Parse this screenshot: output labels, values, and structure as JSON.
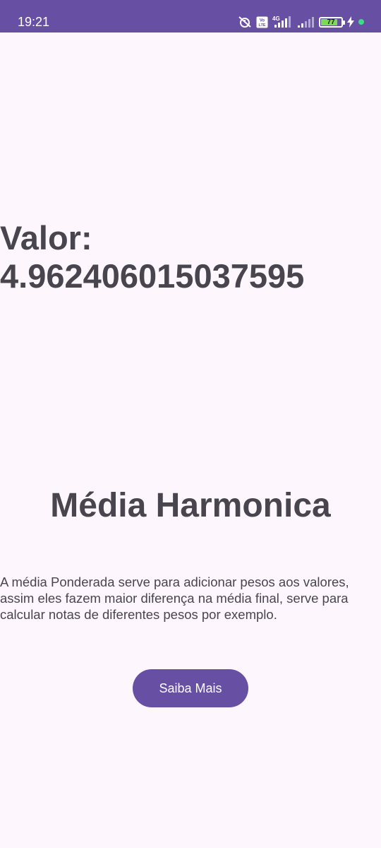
{
  "status_bar": {
    "time": "19:21",
    "battery_level": "77",
    "network_type": "4G",
    "volte_badge": "Vo LTE",
    "icons": [
      "alarm-off-icon",
      "volte-icon",
      "signal-4g-icon",
      "signal-icon",
      "battery-icon",
      "charging-icon",
      "dot-icon"
    ],
    "background_color": "#6750a4",
    "battery_color": "#7ed957",
    "dot_color": "#3ddc84"
  },
  "main": {
    "value_label": "Valor: 4.962406015037595",
    "title": "Média Harmonica",
    "description": "A média Ponderada serve para adicionar pesos aos valores, assim eles fazem maior diferença na média final, serve para calcular notas de diferentes pesos por exemplo.",
    "button_label": "Saiba Mais"
  },
  "colors": {
    "background": "#fdf7fd",
    "text": "#48454e",
    "accent": "#6750a4"
  }
}
